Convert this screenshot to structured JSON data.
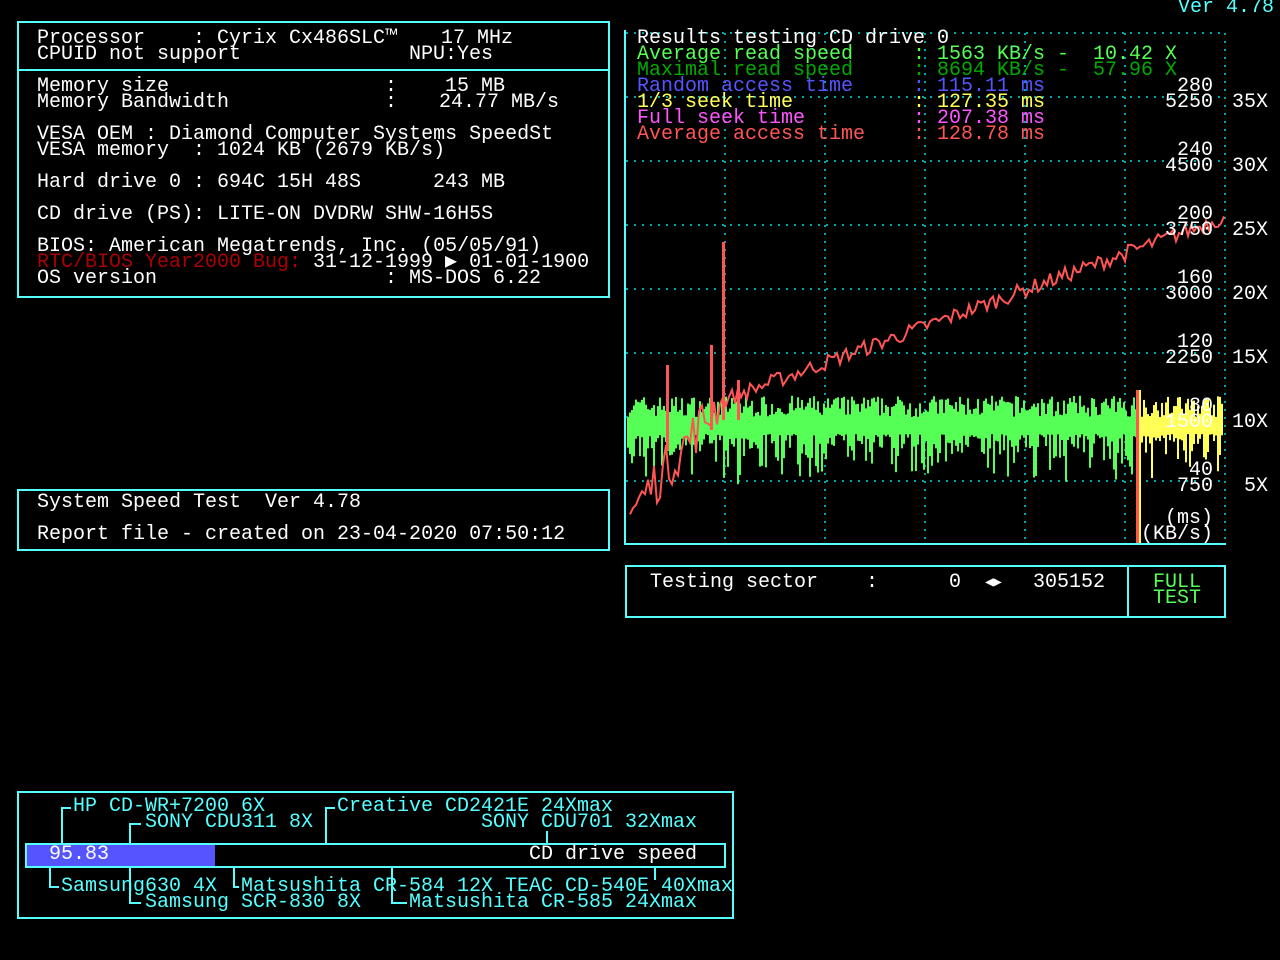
{
  "version": "Ver 4.78",
  "system": {
    "processor_label": "Processor",
    "processor_value": ": Cyrix Cx486SLC™",
    "processor_clock": "17 MHz",
    "cpuid": "CPUID not support",
    "npu": "NPU:Yes",
    "memory_size_label": "Memory size",
    "memory_size_value": "15 MB",
    "memory_bw_label": "Memory Bandwidth",
    "memory_bw_value": "24.77 MB/s",
    "vesa_oem": "VESA OEM : Diamond Computer Systems SpeedSt",
    "vesa_memory": "VESA memory  : 1024 KB (2679 KB/s)",
    "hard_drive_label": "Hard drive 0 : 694C 15H 48S",
    "hard_drive_size": "243 MB",
    "cd_drive": "CD drive (PS): LITE-ON DVDRW SHW-16H5S",
    "bios": "BIOS: American Megatrends, Inc. (05/05/91)",
    "rtc_label": "RTC/BIOS Year2000 Bug:",
    "rtc_value": "31-12-1999 ▶ 01-01-1900",
    "os_label": "OS version",
    "os_value": "MS-DOS 6.22",
    "colon": ":"
  },
  "report": {
    "title": "System Speed Test  Ver 4.78",
    "created": "Report file - created on 23-04-2020 07:50:12"
  },
  "results": {
    "title": "Results testing CD drive 0",
    "rows": [
      {
        "label": "Average read speed",
        "value": "1563 KB/s -  10.42 X",
        "color": "#55ff55"
      },
      {
        "label": "Maximal read speed",
        "value": "8694 KB/s -  57.96 X",
        "color": "#00aa00"
      },
      {
        "label": "Random access time",
        "value": "115.11 ms",
        "color": "#5555ff"
      },
      {
        "label": "1/3 seek time",
        "value": "127.35 ms",
        "color": "#ffff55"
      },
      {
        "label": "Full seek time",
        "value": "207.38 ms",
        "color": "#ff55ff"
      },
      {
        "label": "Average access time",
        "value": "128.78 ms",
        "color": "#ff5555"
      }
    ],
    "sep": ":"
  },
  "chart_axes": {
    "ms_ticks": [
      "280",
      "240",
      "200",
      "160",
      "120",
      "80",
      "40"
    ],
    "kbs_ticks": [
      "5250",
      "4500",
      "3750",
      "3000",
      "2250",
      "1500",
      "750"
    ],
    "x_ticks": [
      "35X",
      "30X",
      "25X",
      "20X",
      "15X",
      "10X",
      "5X"
    ],
    "unit_ms": "(ms)",
    "unit_kbs": "(KB/s)",
    "colors": {
      "read_speed": "#55ff55",
      "access_time": "#ff5555",
      "seek": "#ffff55",
      "grid": "#00aaaa"
    }
  },
  "testing": {
    "label": "Testing sector    :",
    "from": "0",
    "arrows": "◀▶",
    "to": "305152",
    "button_line1": "FULL",
    "button_line2": "TEST"
  },
  "cd_speed": {
    "value": "95.83",
    "label": "CD drive speed",
    "bar_percent": 27,
    "refs": {
      "hp": "HP CD-WR+7200 6X",
      "creative": "Creative CD2421E 24Xmax",
      "sony311": "SONY CDU311 8X",
      "sony701": "SONY CDU701 32Xmax",
      "samsung630": "Samsung630 4X",
      "mat584": "Matsushita CR-584 12X",
      "teac": "TEAC CD-540E 40Xmax",
      "samsung830": "Samsung SCR-830 8X",
      "mat585": "Matsushita CR-585 24Xmax"
    }
  }
}
